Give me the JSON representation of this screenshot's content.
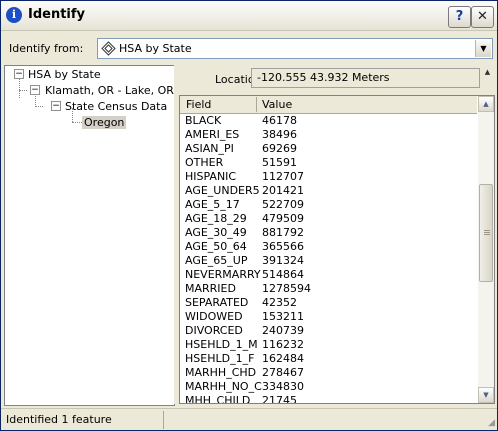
{
  "window": {
    "title": "Identify",
    "help_label": "?",
    "close_label": "✕"
  },
  "identify_from": {
    "label": "Identify from:",
    "selected": "HSA by State"
  },
  "tree": {
    "items": [
      {
        "label": "HSA by State",
        "expander": "−"
      },
      {
        "label": "Klamath, OR - Lake, OR",
        "expander": "−"
      },
      {
        "label": "State Census Data",
        "expander": "−"
      },
      {
        "label": "Oregon"
      }
    ]
  },
  "location": {
    "label": "Location:",
    "value": "-120.555  43.932 Meters"
  },
  "grid": {
    "headers": {
      "field": "Field",
      "value": "Value"
    },
    "rows": [
      {
        "field": "BLACK",
        "value": "46178"
      },
      {
        "field": "AMERI_ES",
        "value": "38496"
      },
      {
        "field": "ASIAN_PI",
        "value": "69269"
      },
      {
        "field": "OTHER",
        "value": "51591"
      },
      {
        "field": "HISPANIC",
        "value": "112707"
      },
      {
        "field": "AGE_UNDER5",
        "value": "201421"
      },
      {
        "field": "AGE_5_17",
        "value": "522709"
      },
      {
        "field": "AGE_18_29",
        "value": "479509"
      },
      {
        "field": "AGE_30_49",
        "value": "881792"
      },
      {
        "field": "AGE_50_64",
        "value": "365566"
      },
      {
        "field": "AGE_65_UP",
        "value": "391324"
      },
      {
        "field": "NEVERMARRY",
        "value": "514864"
      },
      {
        "field": "MARRIED",
        "value": "1278594"
      },
      {
        "field": "SEPARATED",
        "value": "42352"
      },
      {
        "field": "WIDOWED",
        "value": "153211"
      },
      {
        "field": "DIVORCED",
        "value": "240739"
      },
      {
        "field": "HSEHLD_1_M",
        "value": "116232"
      },
      {
        "field": "HSEHLD_1_F",
        "value": "162484"
      },
      {
        "field": "MARHH_CHD",
        "value": "278467"
      },
      {
        "field": "MARHH_NO_C",
        "value": "334830"
      },
      {
        "field": "MHH_CHILD",
        "value": "21745"
      }
    ]
  },
  "status": {
    "text": "Identified 1 feature"
  },
  "icons": {
    "title": "info-icon",
    "combo": "layer-icon",
    "dropdown": "chevron-down-icon",
    "scroll_up": "arrow-up-icon",
    "scroll_down": "arrow-down-icon"
  }
}
